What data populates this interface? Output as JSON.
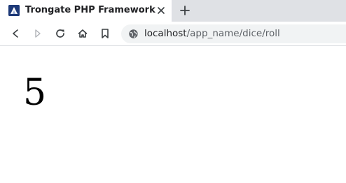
{
  "browser": {
    "tab": {
      "title": "Trongate PHP Framework",
      "favicon": "trongate-logo-icon"
    },
    "toolbar": {
      "icons": [
        "back-icon",
        "forward-icon",
        "reload-icon",
        "home-icon",
        "bookmark-icon",
        "site-info-icon"
      ]
    },
    "address_bar": {
      "host": "localhost",
      "path": "/app_name/dice/roll"
    }
  },
  "page": {
    "dice_result": "5"
  },
  "colors": {
    "tabbar_bg": "#dfe1e5",
    "urlbar_bg": "#f1f3f4",
    "favicon_bg": "#1e3a78"
  }
}
